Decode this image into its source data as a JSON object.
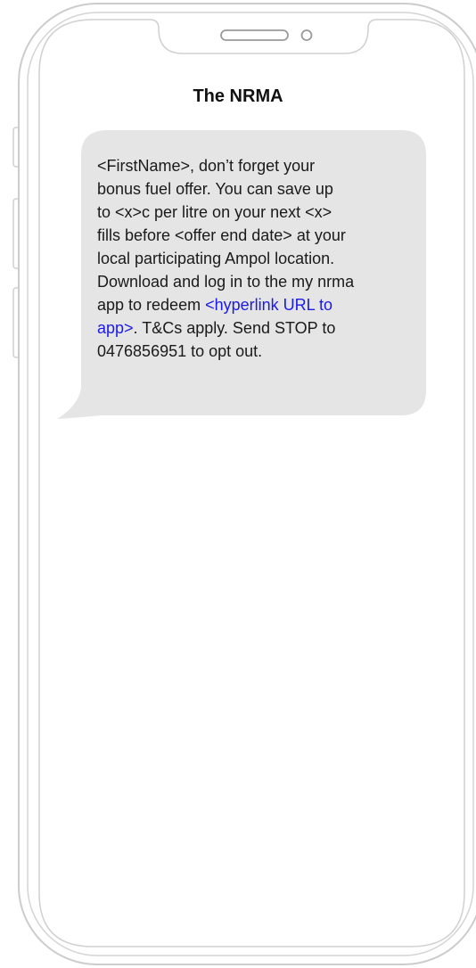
{
  "conversation": {
    "sender_name": "The NRMA"
  },
  "message": {
    "lines": [
      "<FirstName>, don’t forget your",
      "bonus fuel offer. You can save up",
      "to <x>c per litre on your next <x>",
      "fills before <offer end date> at your",
      "local participating Ampol location.",
      "Download and log in to the my nrma"
    ],
    "line7_before_link": "app to redeem ",
    "link_part1": "<hyperlink URL to",
    "link_part2": "app>",
    "line8_after_link": ". T&Cs apply. Send STOP to",
    "line9": "0476856951 to opt out."
  },
  "colors": {
    "bubble": "#e5e5e5",
    "link": "#1a1ae6",
    "phone_outline": "#c8c8c8"
  }
}
